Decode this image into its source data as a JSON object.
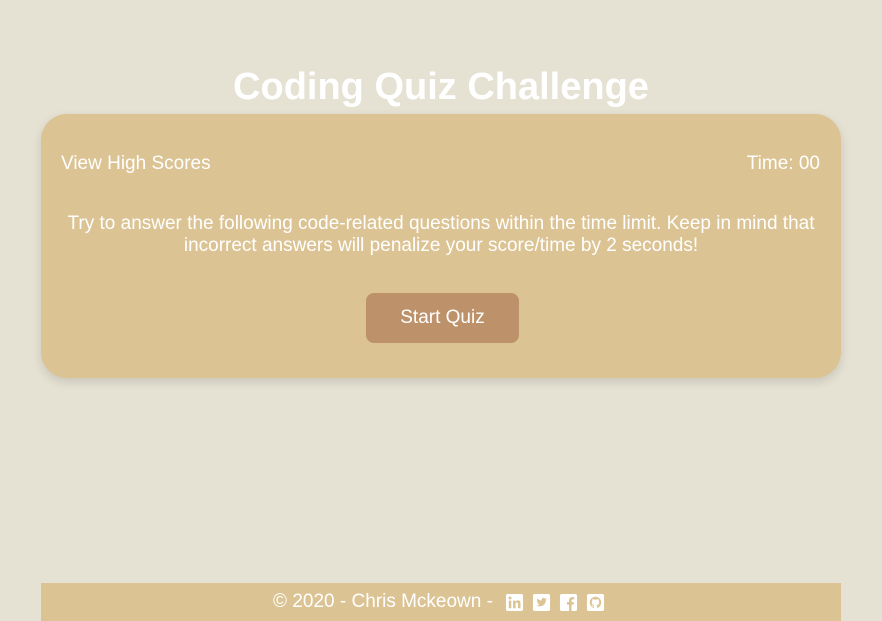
{
  "page": {
    "title": "Coding Quiz Challenge"
  },
  "quiz": {
    "high_scores_label": "View High Scores",
    "timer_text": "Time: 00",
    "instructions": "Try to answer the following code-related questions within the time limit. Keep in mind that incorrect answers will penalize your score/time by 2 seconds!",
    "start_button_label": "Start Quiz"
  },
  "footer": {
    "text": "© 2020 - Chris Mckeown -",
    "social_icons": [
      "linkedin-icon",
      "twitter-icon",
      "facebook-icon",
      "github-icon"
    ]
  },
  "colors": {
    "background": "#e5e1d3",
    "card": "#dbc393",
    "button": "#bd926a",
    "text": "#ffffff"
  }
}
